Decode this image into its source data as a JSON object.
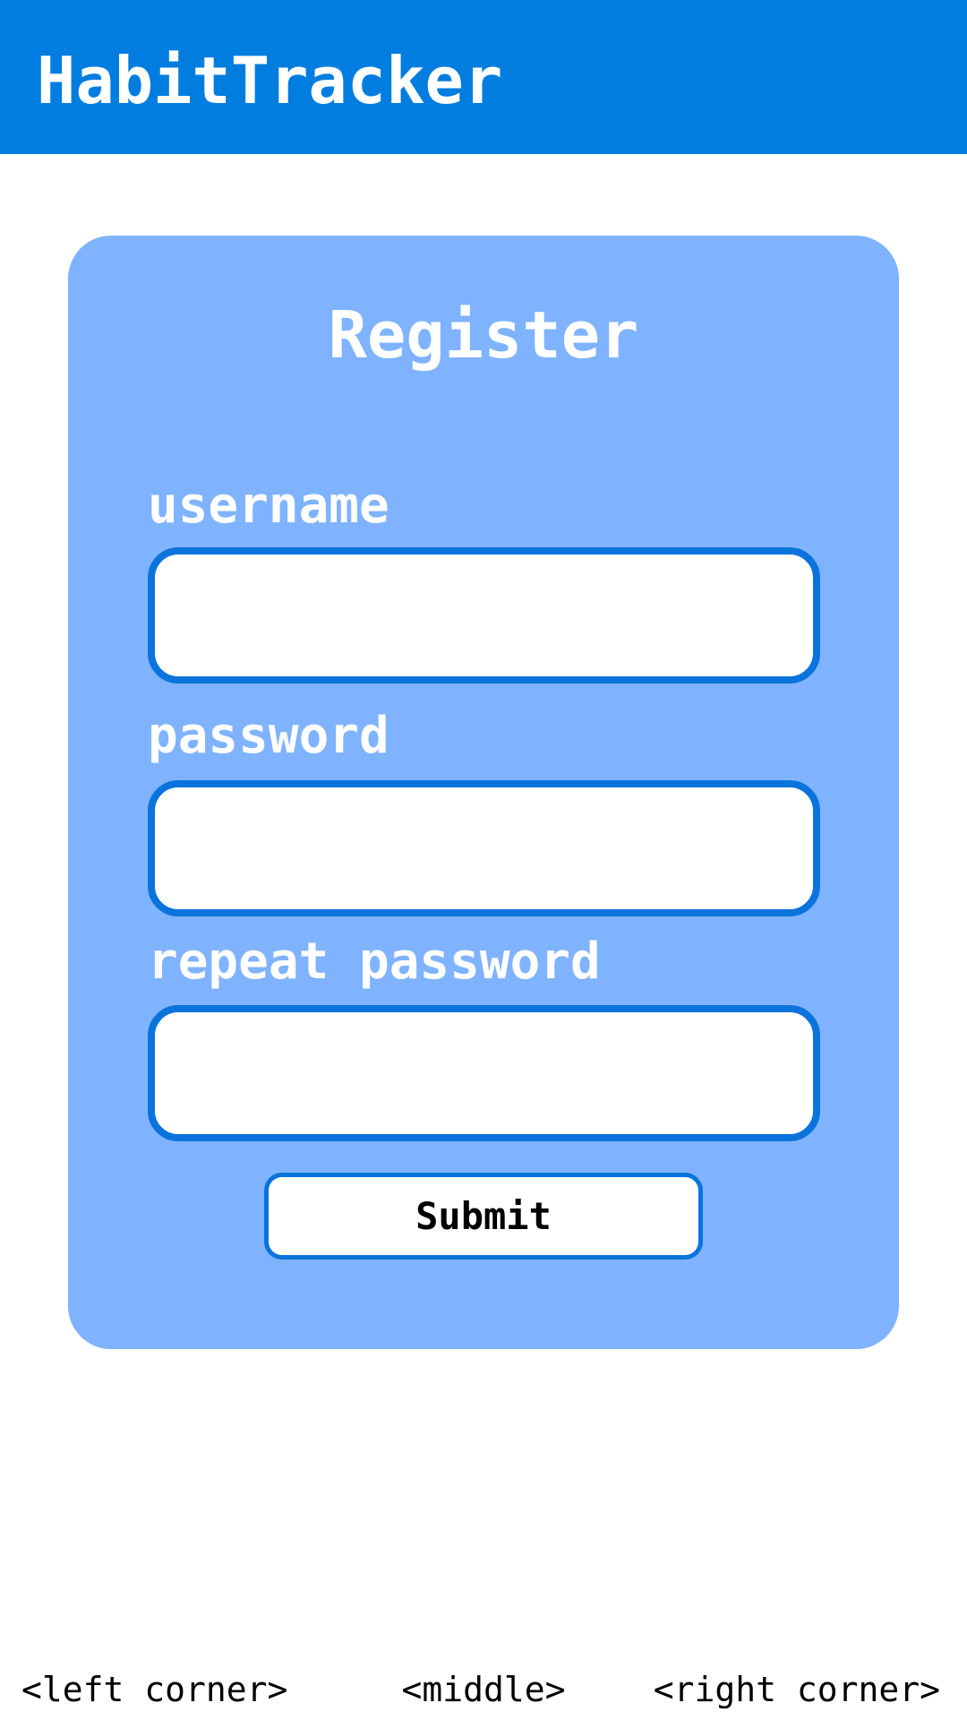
{
  "header": {
    "title": "HabitTracker",
    "background_color": "#007ddf"
  },
  "register_card": {
    "title": "Register",
    "background_color": "#80b3ff",
    "fields": [
      {
        "label": "username",
        "value": "",
        "placeholder": ""
      },
      {
        "label": "password",
        "value": "",
        "placeholder": ""
      },
      {
        "label": "repeat password",
        "value": "",
        "placeholder": ""
      }
    ],
    "field_border_color": "#0b73dc",
    "submit_label": "Submit"
  },
  "footer": {
    "left": "<left corner>",
    "middle": "<middle>",
    "right": "<right corner>"
  }
}
